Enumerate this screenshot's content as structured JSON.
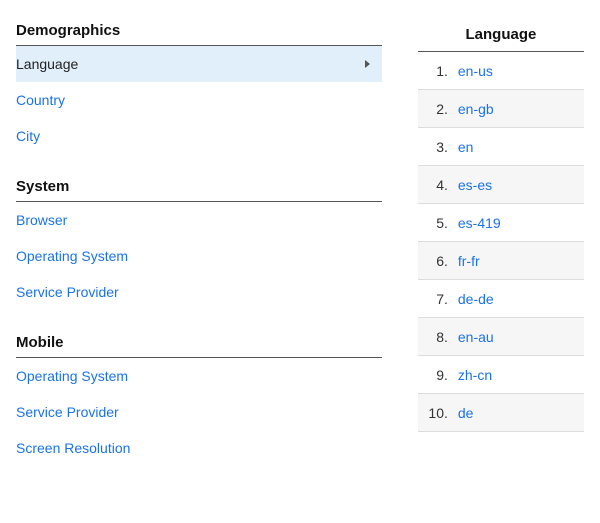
{
  "left": {
    "sections": [
      {
        "title": "Demographics",
        "items": [
          {
            "label": "Language",
            "selected": true
          },
          {
            "label": "Country"
          },
          {
            "label": "City"
          }
        ]
      },
      {
        "title": "System",
        "items": [
          {
            "label": "Browser"
          },
          {
            "label": "Operating System"
          },
          {
            "label": "Service Provider"
          }
        ]
      },
      {
        "title": "Mobile",
        "items": [
          {
            "label": "Operating System"
          },
          {
            "label": "Service Provider"
          },
          {
            "label": "Screen Resolution"
          }
        ]
      }
    ]
  },
  "right": {
    "header": "Language",
    "rows": [
      {
        "value": "en-us"
      },
      {
        "value": "en-gb"
      },
      {
        "value": "en"
      },
      {
        "value": "es-es"
      },
      {
        "value": "es-419"
      },
      {
        "value": "fr-fr"
      },
      {
        "value": "de-de"
      },
      {
        "value": "en-au"
      },
      {
        "value": "zh-cn"
      },
      {
        "value": "de"
      }
    ]
  }
}
